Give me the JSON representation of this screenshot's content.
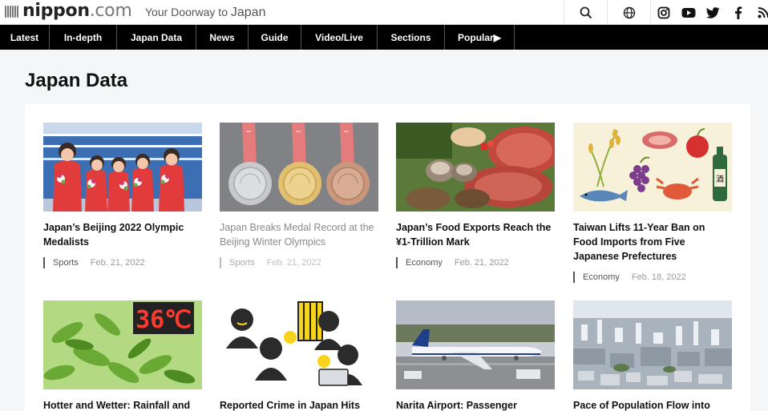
{
  "header": {
    "logo": {
      "part1": "nippon",
      "part2": ".com"
    },
    "tagline": {
      "prefix": "Your Doorway to",
      "big": "Japan"
    },
    "icons": [
      "search-icon",
      "globe-icon",
      "instagram-icon",
      "youtube-icon",
      "twitter-icon",
      "facebook-icon",
      "rss-icon"
    ]
  },
  "nav": {
    "items": [
      {
        "label": "Latest"
      },
      {
        "label": "In-depth"
      },
      {
        "label": "Japan Data"
      },
      {
        "label": "News"
      },
      {
        "label": "Guide"
      },
      {
        "label": "Video/Live"
      },
      {
        "label": "Sections"
      },
      {
        "label": "Popular▶"
      }
    ]
  },
  "page": {
    "title": "Japan Data"
  },
  "cards": [
    {
      "title": "Japan’s Beijing 2022 Olympic Medalists",
      "category": "Sports",
      "date": "Feb. 21, 2022"
    },
    {
      "title": "Japan Breaks Medal Record at the Beijing Winter Olympics",
      "category": "Sports",
      "date": "Feb. 21, 2022"
    },
    {
      "title": "Japan’s Food Exports Reach the ¥1-Trillion Mark",
      "category": "Economy",
      "date": "Feb. 21, 2022"
    },
    {
      "title": "Taiwan Lifts 11-Year Ban on Food Imports from Five Japanese Prefectures",
      "category": "Economy",
      "date": "Feb. 18, 2022"
    },
    {
      "title": "Hotter and Wetter: Rainfall and"
    },
    {
      "title": "Reported Crime in Japan Hits"
    },
    {
      "title": "Narita Airport: Passenger"
    },
    {
      "title": "Pace of Population Flow into"
    }
  ],
  "images": {
    "temperature_display": "36℃",
    "sake_label": "酒"
  }
}
